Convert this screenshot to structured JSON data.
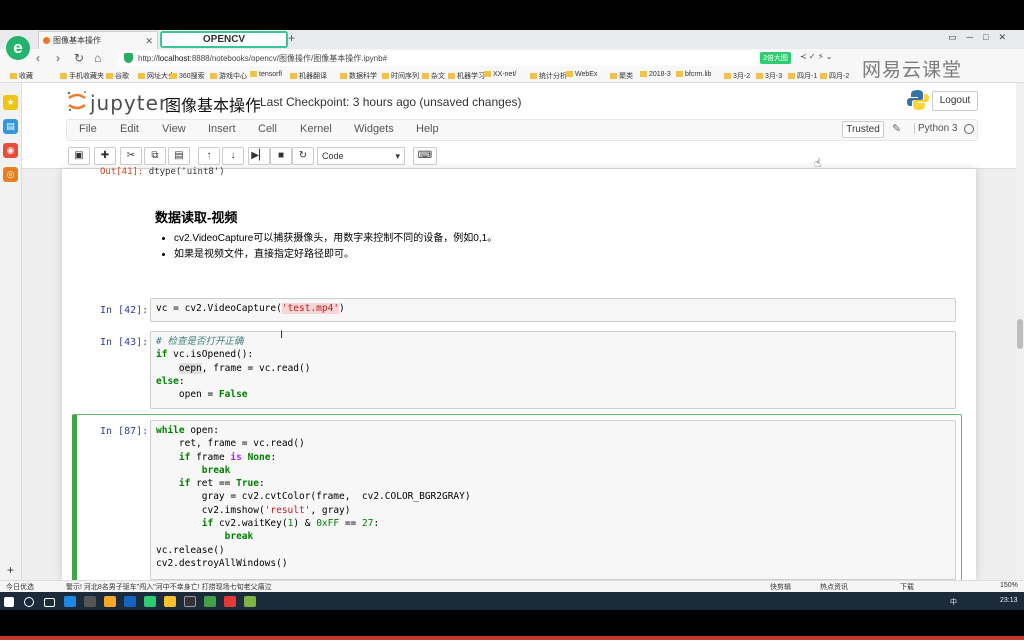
{
  "browser": {
    "tabs": [
      {
        "label": "图像基本操作"
      },
      {
        "label": "OPENCV"
      }
    ],
    "url_prefix": "http://",
    "url_host": "localhost",
    "url_path": ":8888/notebooks/opencv/图像操作/图像基本操作.ipynb#",
    "zoom_badge": "3倍大图",
    "bookmarks": [
      "收藏",
      "手机收藏夹",
      "谷歌",
      "网址大全",
      "360搜索",
      "游戏中心",
      "tensorfl",
      "机器翻译",
      "数据科学",
      "时间序列",
      "杂文",
      "机器学习",
      "XX-net/",
      "统计分析",
      "WebEx",
      "聚类",
      "2018-3",
      "bfcrm.lib",
      "3月-2",
      "3月-3",
      "四月-1",
      "四月-2"
    ]
  },
  "watermark": "网易云课堂",
  "jupyter": {
    "logo": "jupyter",
    "notebook_title": "图像基本操作",
    "checkpoint": "Last Checkpoint: 3 hours ago (unsaved changes)",
    "logout": "Logout",
    "menus": [
      "File",
      "Edit",
      "View",
      "Insert",
      "Cell",
      "Kernel",
      "Widgets",
      "Help"
    ],
    "trusted": "Trusted",
    "kernel": "Python 3",
    "cell_type": "Code"
  },
  "notebook": {
    "prev_output_prompt": "Out[41]:",
    "prev_output_value": "dtype('uint8')",
    "md_heading": "数据读取-视频",
    "md_items": [
      "cv2.VideoCapture可以捕获摄像头，用数字来控制不同的设备，例如0,1。",
      "如果是视频文件，直接指定好路径即可。"
    ],
    "cells": [
      {
        "prompt": "In [42]:"
      },
      {
        "prompt": "In [43]:"
      },
      {
        "prompt": "In [87]:"
      }
    ]
  },
  "statusbar": {
    "left": "今日优选",
    "news": "警示! 河北8名男子驱车\"闯入\"河中不幸身亡! 打捞现场七旬老父痛泣",
    "right_items": [
      "快剪辑",
      "热点资讯",
      "下载",
      "150%"
    ]
  },
  "taskbar": {
    "lang": "中",
    "time": "23:13"
  }
}
